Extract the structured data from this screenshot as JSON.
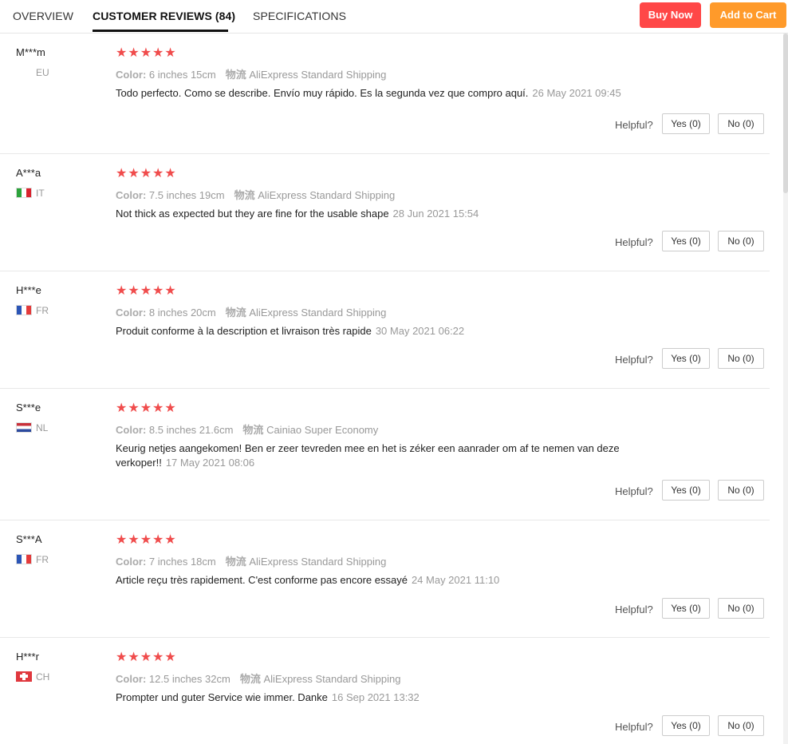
{
  "tabs": {
    "overview": "OVERVIEW",
    "reviews": "CUSTOMER REVIEWS (84)",
    "specs": "SPECIFICATIONS"
  },
  "actions": {
    "buy_now": "Buy Now",
    "add_to_cart": "Add to Cart"
  },
  "colors": {
    "buy_now": "#ff4747",
    "add_to_cart": "#ff9a2a",
    "stars": "#f04c4c"
  },
  "labels": {
    "color": "Color:",
    "shipping": "物流",
    "helpful": "Helpful?",
    "yes": "Yes (0)",
    "no": "No (0)",
    "stars": "★★★★★"
  },
  "reviews": [
    {
      "user": "M***m",
      "country": "EU",
      "flag": "eu-flag",
      "rating": 5,
      "color": "6 inches 15cm",
      "shipping": "AliExpress Standard Shipping",
      "text": "Todo perfecto. Como se describe. Envío muy rápido. Es la segunda vez que compro aquí.",
      "date": "26 May 2021 09:45"
    },
    {
      "user": "A***a",
      "country": "IT",
      "flag": "italy-flag",
      "rating": 5,
      "color": "7.5 inches 19cm",
      "shipping": "AliExpress Standard Shipping",
      "text": "Not thick as expected but they are fine for the usable shape",
      "date": "28 Jun 2021 15:54"
    },
    {
      "user": "H***e",
      "country": "FR",
      "flag": "france-flag",
      "rating": 5,
      "color": "8 inches 20cm",
      "shipping": "AliExpress Standard Shipping",
      "text": "Produit conforme à la description et livraison très rapide",
      "date": "30 May 2021 06:22"
    },
    {
      "user": "S***e",
      "country": "NL",
      "flag": "netherlands-flag",
      "rating": 5,
      "color": "8.5 inches 21.6cm",
      "shipping": "Cainiao Super Economy",
      "text": "Keurig netjes aangekomen! Ben er zeer tevreden mee en het is zéker een aanrader om af te nemen van deze verkoper!!",
      "date": "17 May 2021 08:06"
    },
    {
      "user": "S***A",
      "country": "FR",
      "flag": "france-flag",
      "rating": 5,
      "color": "7 inches 18cm",
      "shipping": "AliExpress Standard Shipping",
      "text": "Article reçu très rapidement. C'est conforme pas encore essayé",
      "date": "24 May 2021 11:10"
    },
    {
      "user": "H***r",
      "country": "CH",
      "flag": "switzerland-flag",
      "rating": 5,
      "color": "12.5 inches 32cm",
      "shipping": "AliExpress Standard Shipping",
      "text": "Prompter und guter Service wie immer. Danke",
      "date": "16 Sep 2021 13:32"
    }
  ]
}
